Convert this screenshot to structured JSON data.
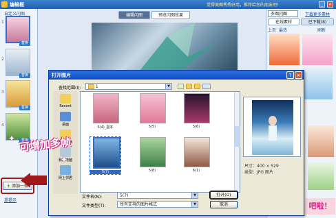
{
  "app": {
    "title": "编辑框",
    "slogan": "觉得美图秀秀好用，推荐给您的朋友吧！"
  },
  "left": {
    "title": "自定义闪图",
    "replace_label": "替换",
    "frame_numbers": [
      "1",
      "2",
      "3",
      "4"
    ],
    "add_frame": "添加一帧",
    "hint": "提提示"
  },
  "center": {
    "tab_edit": "编辑闪图",
    "tab_preview": "预览闪图效果"
  },
  "right": {
    "dropdown": "多图闪图",
    "download_more": "下载更多素材",
    "tab_online": "在线素材",
    "tab_downloaded": "已下载(8)",
    "nav_prev": "上页",
    "nav_all": "最热",
    "nav_refresh": "刷新",
    "bottom_text": "吧啦！"
  },
  "dialog": {
    "title": "打开图片",
    "look_in_label": "查找范围(I):",
    "look_in_value": "1",
    "places": [
      "Recent",
      "桌面",
      "我的文档",
      "我的电脑",
      "网上邻居"
    ],
    "files": [
      {
        "name": "5(4)_副本",
        "colors": [
          "#f2b6c9",
          "#c8667e"
        ]
      },
      {
        "name": "5(5)",
        "colors": [
          "#f5c2d3",
          "#e07a9a"
        ]
      },
      {
        "name": "5(6)",
        "colors": [
          "#2a1330",
          "#a83a6a"
        ]
      },
      {
        "name": "5(7)",
        "colors": [
          "#7fb6e4",
          "#1e4e8a"
        ]
      },
      {
        "name": "5(8)",
        "colors": [
          "#a9d79a",
          "#3f7f4a"
        ]
      },
      {
        "name": "6(1)",
        "colors": [
          "#f4e6d8",
          "#8e5a48"
        ]
      }
    ],
    "preview_size_label": "尺寸：",
    "preview_size_value": "400 × 529",
    "preview_type_label": "类型：",
    "preview_type_value": "JPG 图片",
    "filename_label": "文件名(N):",
    "filename_value": "5(7)",
    "filetype_label": "文件类型(T):",
    "filetype_value": "所有支持的图片格式",
    "open_button": "打开(O)",
    "cancel_button": "取消"
  },
  "callout": "可增加多帧",
  "colors": {
    "title_blue": "#0b4cc4",
    "callout_pink": "#d0308a",
    "add_button_border": "#a01818"
  }
}
